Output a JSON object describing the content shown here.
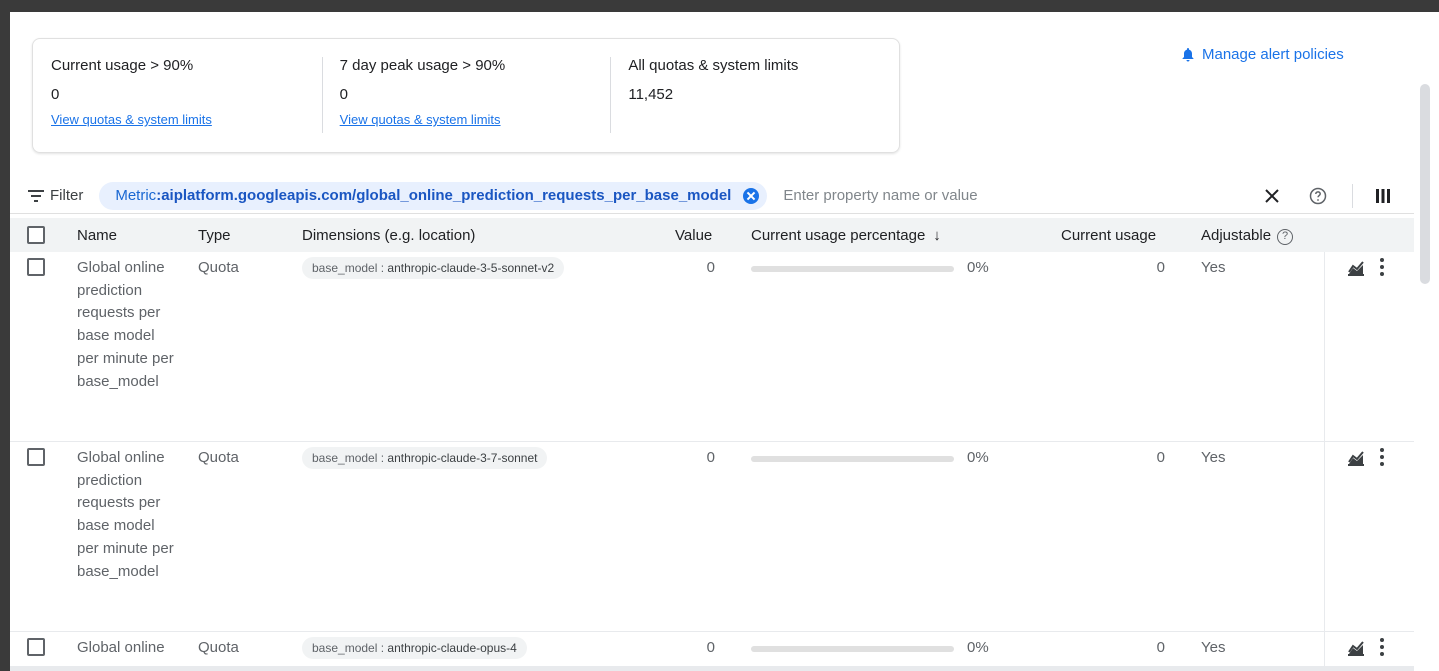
{
  "summary": {
    "cards": [
      {
        "title": "Current usage > 90%",
        "value": "0",
        "link": "View quotas & system limits"
      },
      {
        "title": "7 day peak usage > 90%",
        "value": "0",
        "link": "View quotas & system limits"
      },
      {
        "title": "All quotas & system limits",
        "value": "11,452",
        "link": ""
      }
    ]
  },
  "header": {
    "alert_link": "Manage alert policies"
  },
  "filter": {
    "label": "Filter",
    "chip_key": "Metric",
    "chip_sep": " : ",
    "chip_value": "aiplatform.googleapis.com/global_online_prediction_requests_per_base_model",
    "placeholder": "Enter property name or value"
  },
  "table": {
    "columns": {
      "name": "Name",
      "type": "Type",
      "dimensions": "Dimensions (e.g. location)",
      "value": "Value",
      "usage_pct": "Current usage percentage",
      "sort_arrow": "↓",
      "current_usage": "Current usage",
      "adjustable": "Adjustable",
      "help": "?"
    },
    "rows": [
      {
        "name": "Global online prediction requests per base model per minute per base_model",
        "type": "Quota",
        "dim_key": "base_model : ",
        "dim_value": "anthropic-claude-3-5-sonnet-v2",
        "value": "0",
        "usage_pct": "0%",
        "usage_fraction": 0,
        "current_usage": "0",
        "adjustable": "Yes"
      },
      {
        "name": "Global online prediction requests per base model per minute per base_model",
        "type": "Quota",
        "dim_key": "base_model : ",
        "dim_value": "anthropic-claude-3-7-sonnet",
        "value": "0",
        "usage_pct": "0%",
        "usage_fraction": 0,
        "current_usage": "0",
        "adjustable": "Yes"
      },
      {
        "name": "Global online",
        "type": "Quota",
        "dim_key": "base_model : ",
        "dim_value": "anthropic-claude-opus-4",
        "value": "0",
        "usage_pct": "0%",
        "usage_fraction": 0,
        "current_usage": "0",
        "adjustable": "Yes"
      }
    ]
  },
  "colors": {
    "accent": "#1a73e8",
    "chip_bg": "#e8f0fe"
  }
}
